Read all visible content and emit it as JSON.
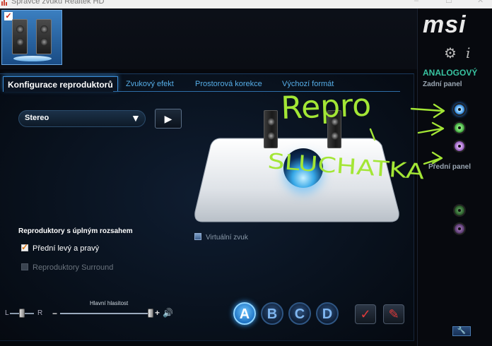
{
  "window": {
    "title": "Správce zvuku Realtek HD"
  },
  "brand": {
    "logo_text": "msi"
  },
  "tabs": [
    {
      "label": "Konfigurace reproduktorů",
      "active": true
    },
    {
      "label": "Zvukový efekt",
      "active": false
    },
    {
      "label": "Prostorová korekce",
      "active": false
    },
    {
      "label": "Výchozí formát",
      "active": false
    }
  ],
  "speaker_config": {
    "selected": "Stereo"
  },
  "virtual_sound": {
    "label": "Virtuální zvuk",
    "checked": false
  },
  "full_range": {
    "title": "Reproduktory s úplným rozsahem",
    "front_label": "Přední levý a pravý",
    "front_checked": true,
    "surround_label": "Reproduktory Surround",
    "surround_checked": false
  },
  "volume": {
    "label": "Hlavní hlasitost",
    "balance_left": "L",
    "balance_right": "R",
    "minus": "−",
    "plus": "+",
    "level": 1.0,
    "balance": 0.5
  },
  "profiles": [
    "A",
    "B",
    "C",
    "D"
  ],
  "active_profile": "A",
  "right_panel": {
    "connector_mode": "ANALOGOVÝ",
    "rear_panel": "Zadní panel",
    "front_panel": "Přední panel",
    "rear_jacks": [
      "blue",
      "green",
      "purple"
    ],
    "front_jacks": [
      "dark-green",
      "dark-purple"
    ]
  },
  "annotations": {
    "repro": "Repro",
    "sluchatka": "SLUCHATKA"
  },
  "colors": {
    "accent": "#3b8ed8",
    "analog_label": "#38c2a0",
    "annotation": "#a3e635"
  }
}
